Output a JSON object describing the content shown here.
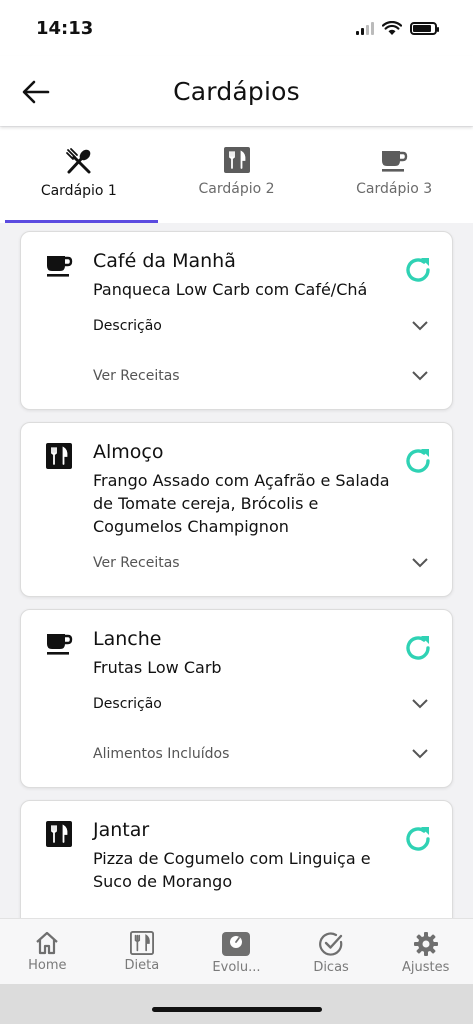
{
  "status": {
    "time": "14:13"
  },
  "header": {
    "title": "Cardápios"
  },
  "tabs": [
    {
      "label": "Cardápio 1",
      "icon": "utensils-crossed-icon",
      "active": true
    },
    {
      "label": "Cardápio 2",
      "icon": "fork-knife-box-icon",
      "active": false
    },
    {
      "label": "Cardápio 3",
      "icon": "coffee-cup-icon",
      "active": false
    }
  ],
  "meals": [
    {
      "title": "Café da Manhã",
      "description": "Panqueca Low Carb com Café/Chá",
      "icon": "coffee-cup-icon",
      "expanders": [
        "Descrição",
        "Ver Receitas"
      ]
    },
    {
      "title": "Almoço",
      "description": "Frango Assado com Açafrão e Salada de Tomate cereja, Brócolis e Cogumelos Champignon",
      "icon": "fork-knife-box-icon",
      "expanders": [
        "Ver Receitas"
      ]
    },
    {
      "title": "Lanche",
      "description": "Frutas Low Carb",
      "icon": "coffee-cup-icon",
      "expanders": [
        "Descrição",
        "Alimentos Incluídos"
      ]
    },
    {
      "title": "Jantar",
      "description": "Pizza de Cogumelo com Linguiça e Suco de Morango",
      "icon": "fork-knife-box-icon",
      "expanders": []
    }
  ],
  "bottom_nav": [
    {
      "label": "Home",
      "icon": "home-icon"
    },
    {
      "label": "Dieta",
      "icon": "fork-knife-box-icon"
    },
    {
      "label": "Evolu...",
      "icon": "scale-icon"
    },
    {
      "label": "Dicas",
      "icon": "check-circle-icon"
    },
    {
      "label": "Ajustes",
      "icon": "gear-icon"
    }
  ],
  "colors": {
    "accent": "#5b4be0",
    "refresh": "#2fd2b4",
    "nav_icon": "#6f6f6f"
  }
}
